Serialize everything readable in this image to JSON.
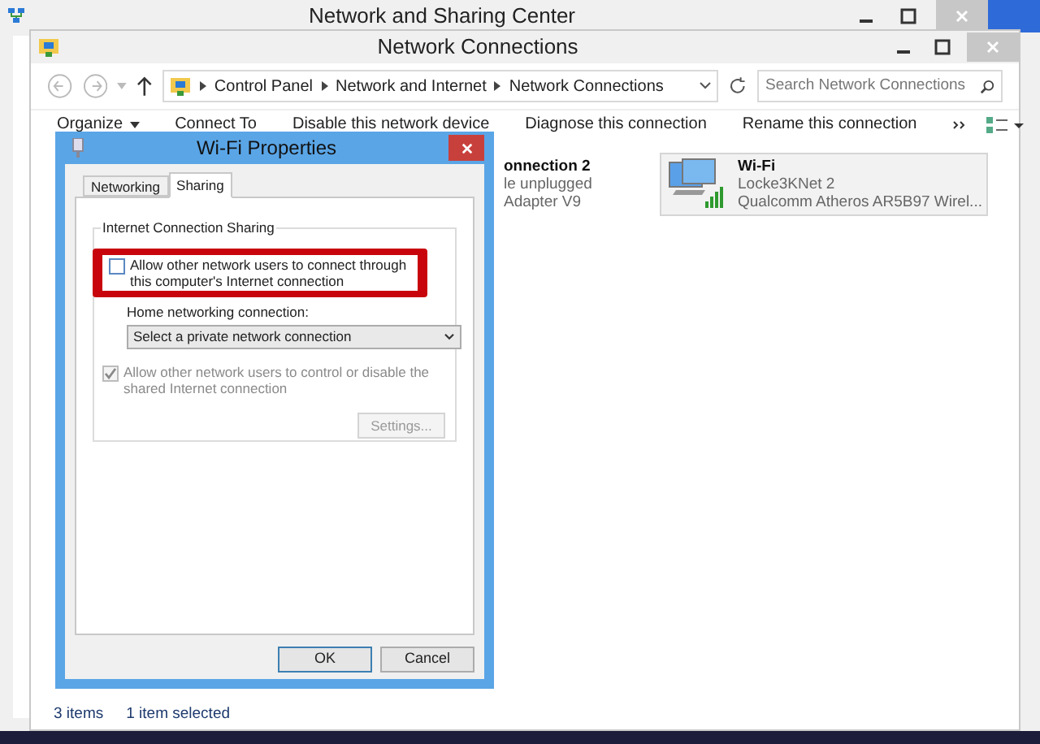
{
  "background_window": {
    "title": "Network and Sharing Center"
  },
  "window": {
    "title": "Network Connections",
    "breadcrumbs": [
      "Control Panel",
      "Network and Internet",
      "Network Connections"
    ],
    "search": {
      "placeholder": "Search Network Connections"
    },
    "toolbar": [
      {
        "label": "Organize",
        "dropdown": true
      },
      {
        "label": "Connect To",
        "dropdown": false
      },
      {
        "label": "Disable this network device",
        "dropdown": false
      },
      {
        "label": "Diagnose this connection",
        "dropdown": false
      },
      {
        "label": "Rename this connection",
        "dropdown": false
      }
    ],
    "connections": [
      {
        "kind": "partial",
        "name": "onnection 2",
        "status": "le unplugged",
        "device": "Adapter V9",
        "selected": false
      },
      {
        "kind": "wifi",
        "name": "Wi-Fi",
        "status": "Locke3KNet  2",
        "device": "Qualcomm Atheros AR5B97 Wirel...",
        "selected": true
      }
    ],
    "status_bar": [
      "3 items",
      "1 item selected"
    ]
  },
  "dialog": {
    "title": "Wi-Fi Properties",
    "tabs": [
      {
        "label": "Networking",
        "selected": false
      },
      {
        "label": "Sharing",
        "selected": true
      }
    ],
    "group_title": "Internet Connection Sharing",
    "allow_connect": {
      "label": "Allow other network users to connect through this computer's Internet connection",
      "checked": false,
      "highlighted": true
    },
    "home_connection": {
      "label": "Home networking connection:",
      "value": "Select a private network connection"
    },
    "allow_control": {
      "label": "Allow other network users to control or disable the shared Internet connection",
      "checked": true,
      "disabled": true
    },
    "settings_button": {
      "label": "Settings...",
      "disabled": true
    },
    "buttons": [
      "OK",
      "Cancel"
    ]
  }
}
